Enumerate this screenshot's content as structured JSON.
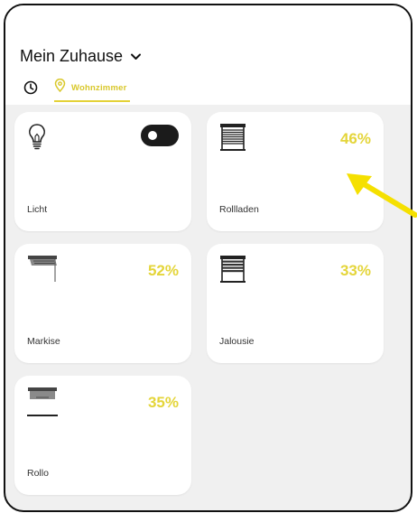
{
  "header": {
    "title": "Mein Zuhause"
  },
  "tabs": [
    {
      "icon": "clock-icon",
      "label": ""
    },
    {
      "icon": "location-pin-icon",
      "label": "Wohnzimmer",
      "active": true
    }
  ],
  "devices": [
    {
      "name": "Licht",
      "icon": "light-bulb-icon",
      "toggle": "on"
    },
    {
      "name": "Rollladen",
      "icon": "roller-shutter-icon",
      "value": "46%"
    },
    {
      "name": "Markise",
      "icon": "awning-icon",
      "value": "52%"
    },
    {
      "name": "Jalousie",
      "icon": "venetian-blind-icon",
      "value": "33%"
    },
    {
      "name": "Rollo",
      "icon": "roller-blind-icon",
      "value": "35%"
    }
  ],
  "colors": {
    "accent": "#e4d53a",
    "annotation_arrow": "#f5e000",
    "background": "#f0f0f0",
    "toggle": "#1b1b1b"
  }
}
